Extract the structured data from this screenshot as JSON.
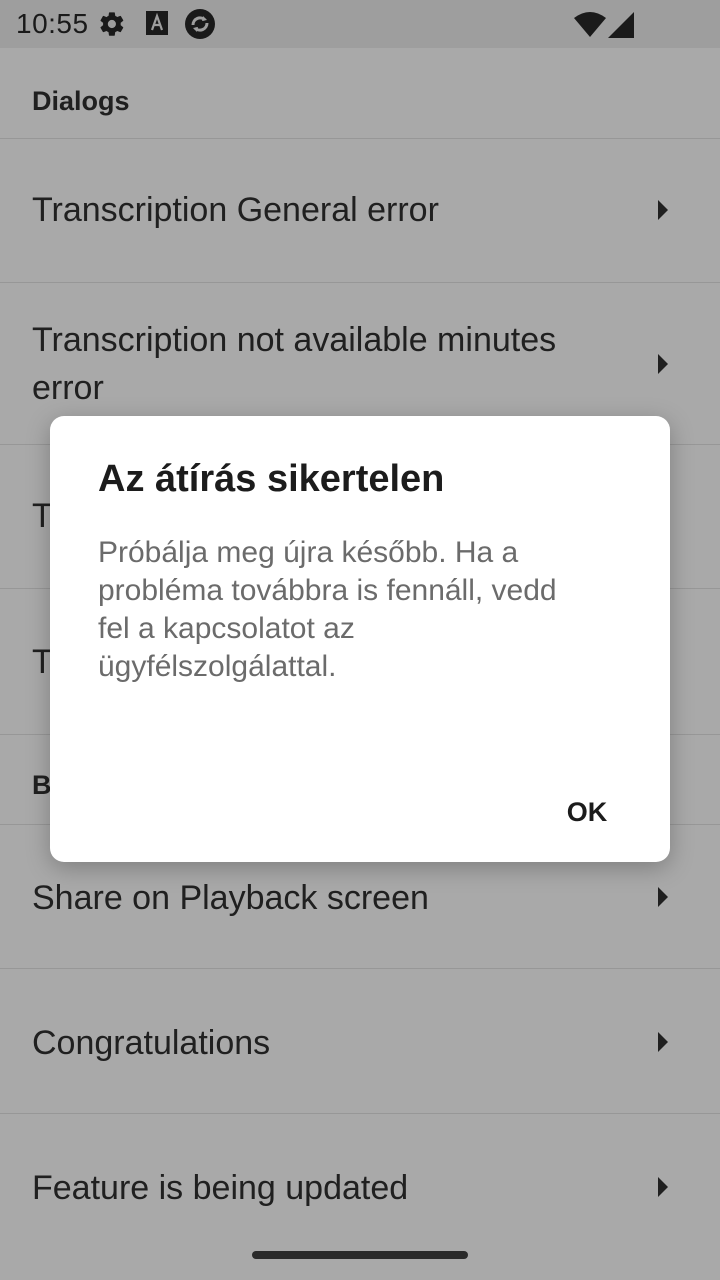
{
  "status_bar": {
    "time": "10:55",
    "icons": [
      "gear-icon",
      "font-icon",
      "sync-icon",
      "wifi-icon",
      "signal-icon"
    ]
  },
  "list": {
    "section1_header": "Dialogs",
    "row1_label": "Transcription General error",
    "row2_label": "Transcription not available minutes error",
    "row3_partial": "T",
    "row4_partial": "T",
    "section2_partial": "B",
    "row5_label": "Share on Playback screen",
    "row6_label": "Congratulations",
    "row7_label": "Feature is being updated"
  },
  "dialog": {
    "title": "Az átírás sikertelen",
    "message": "Próbálja meg újra később. Ha a probléma továbbra is fennáll, vedd fel a kapcsolatot az ügyfélszolgálattal.",
    "ok_label": "OK"
  },
  "colors": {
    "scrim_background": "#a9a9a9",
    "dialog_background": "#ffffff",
    "dialog_title": "#1c1c1c",
    "dialog_message": "#6b6b6b"
  }
}
